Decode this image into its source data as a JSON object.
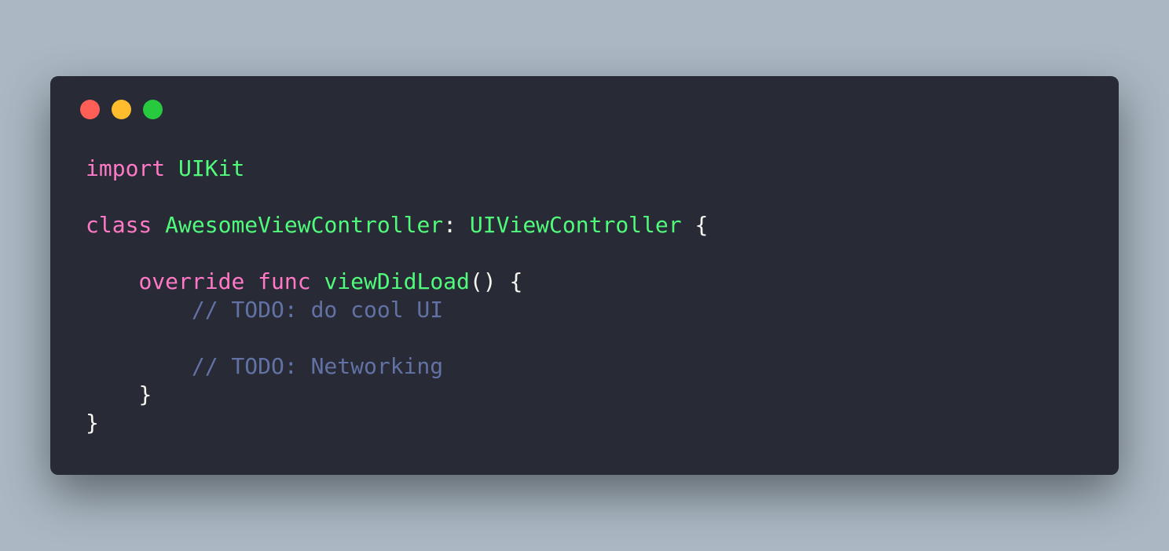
{
  "window": {
    "controls": [
      {
        "name": "close",
        "color": "#ff5f56"
      },
      {
        "name": "minimize",
        "color": "#ffbd2e"
      },
      {
        "name": "zoom",
        "color": "#27c93f"
      }
    ]
  },
  "code": {
    "line1": {
      "kw": "import",
      "sp": " ",
      "type": "UIKit"
    },
    "line3": {
      "kw": "class",
      "sp1": " ",
      "name": "AwesomeViewController",
      "colon": ":",
      "sp2": " ",
      "super": "UIViewController",
      "sp3": " ",
      "brace": "{"
    },
    "line5": {
      "indent": "    ",
      "kw1": "override",
      "sp1": " ",
      "kw2": "func",
      "sp2": " ",
      "fn": "viewDidLoad",
      "parens": "()",
      "sp3": " ",
      "brace": "{"
    },
    "line6": {
      "indent": "        ",
      "comment": "// TODO: do cool UI"
    },
    "line8": {
      "indent": "        ",
      "comment": "// TODO: Networking"
    },
    "line9": {
      "indent": "    ",
      "brace": "}"
    },
    "line10": {
      "brace": "}"
    }
  },
  "theme": {
    "background": "#abb8c3",
    "window_bg": "#282a36",
    "keyword": "#ff79c6",
    "type": "#50fa7b",
    "comment": "#6272a4",
    "text": "#f8f8f2"
  }
}
